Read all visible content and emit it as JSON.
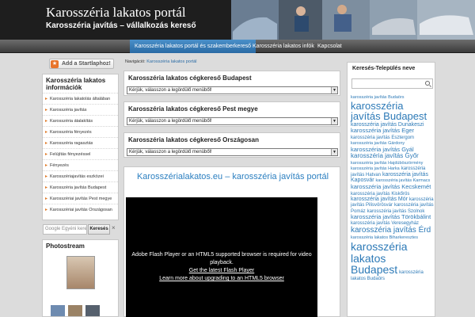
{
  "header": {
    "title": "Karosszéria lakatos portál",
    "description": "Karosszéria javítás – vállalkozás kereső"
  },
  "nav": {
    "items": [
      {
        "label": "Karosszéria lakatos portál és szakemberkereső"
      },
      {
        "label": "Karosszéria lakatos infók"
      },
      {
        "label": "Kapcsolat"
      }
    ]
  },
  "bookmark": {
    "label": "Add a Startlaphoz!"
  },
  "breadcrumb": {
    "prefix": "Navigáció:",
    "current": "Karosszéria lakatos portál"
  },
  "sidebar": {
    "info_title": "Karosszéria lakatos információk",
    "items": [
      {
        "label": "Karosszéria lakatolás általában"
      },
      {
        "label": "Karosszéria javítás"
      },
      {
        "label": "Karosszéria átalakítás"
      },
      {
        "label": "Karosszéria fényezés"
      },
      {
        "label": "Karosszéria ragasztás"
      },
      {
        "label": "Felújítás fényezéssel"
      },
      {
        "label": "Fényezés"
      },
      {
        "label": "Karosszériajavítás eszközei"
      },
      {
        "label": "Karosszéria javítás Budapest"
      },
      {
        "label": "Karosszériai javítás Pest megye"
      },
      {
        "label": "Karosszériai javítás Országosan"
      }
    ],
    "google": {
      "placeholder": "Google  Egyéni keresés",
      "button": "Keresés",
      "close": "×"
    },
    "photostream_title": "Photostream"
  },
  "categories": [
    {
      "title": "Karosszéria lakatos cégkereső Budapest",
      "select": "Kérjük, válasszon a legördülő menüből!"
    },
    {
      "title": "Karosszéria lakatos cégkereső Pest megye",
      "select": "Kérjük, válasszon a legördülő menüből!"
    },
    {
      "title": "Karosszéria lakatos cégkereső Országosan",
      "select": "Kérjük, válasszon a legördülő menüből!"
    }
  ],
  "content": {
    "title": "Karosszérialakatos.eu – karosszéria javítás portál",
    "video_msg_line1": "Adobe Flash Player or an HTML5 supported browser is required for video playback.",
    "video_link1": "Get the latest Flash Player",
    "video_link2": "Learn more about upgrading to an HTML5 browser"
  },
  "right": {
    "title": "Keresés-Település neve",
    "tags": [
      {
        "text": "karosszéria javítás Budaörs",
        "size": 5.5
      },
      {
        "text": "karosszéria javítás Budapest",
        "size": 13
      },
      {
        "text": "karosszéria javítás Dunakeszi",
        "size": 7
      },
      {
        "text": "karosszéria javítás Eger",
        "size": 7.5
      },
      {
        "text": "karosszéria javítás Esztergom",
        "size": 6
      },
      {
        "text": "karosszéria javítás Gárdony",
        "size": 5.5
      },
      {
        "text": "karosszéria javítás Gyál",
        "size": 7.5
      },
      {
        "text": "karosszéria javítás Győr",
        "size": 8
      },
      {
        "text": "karosszéria javítás Hajdúböszörmény",
        "size": 5.5
      },
      {
        "text": "karosszéria javítás Harka",
        "size": 5.5
      },
      {
        "text": "karosszéria javítás Hatvan",
        "size": 6
      },
      {
        "text": "karosszéria javítás Kaposvár",
        "size": 7
      },
      {
        "text": "karosszéria javítás Karmacs",
        "size": 5.5
      },
      {
        "text": "karosszéria javítás Kecskemét",
        "size": 7.5
      },
      {
        "text": "karosszéria javítás Kiskőrös",
        "size": 6
      },
      {
        "text": "karosszéria javítás Mór",
        "size": 7
      },
      {
        "text": "karosszéria javítás Pilisvörösvár",
        "size": 6
      },
      {
        "text": "karosszéria javítás Pomáz",
        "size": 6
      },
      {
        "text": "karosszéria javítás Szolnok",
        "size": 6
      },
      {
        "text": "karosszéria javítás Törökbálint",
        "size": 7.5
      },
      {
        "text": "karosszéria javítás Veresegyház",
        "size": 6
      },
      {
        "text": "karosszéria javítás Érd",
        "size": 10
      },
      {
        "text": "karosszéria lakatos Biharkeresztes",
        "size": 5.5
      },
      {
        "text": "karosszéria lakatos Budapest",
        "size": 14
      },
      {
        "text": "karosszéria lakatos Budaörs",
        "size": 6
      }
    ]
  },
  "colors": {
    "accent": "#2b7fc0",
    "nav_active": "#3a80bd",
    "header_bg": "#1e1e1e"
  }
}
